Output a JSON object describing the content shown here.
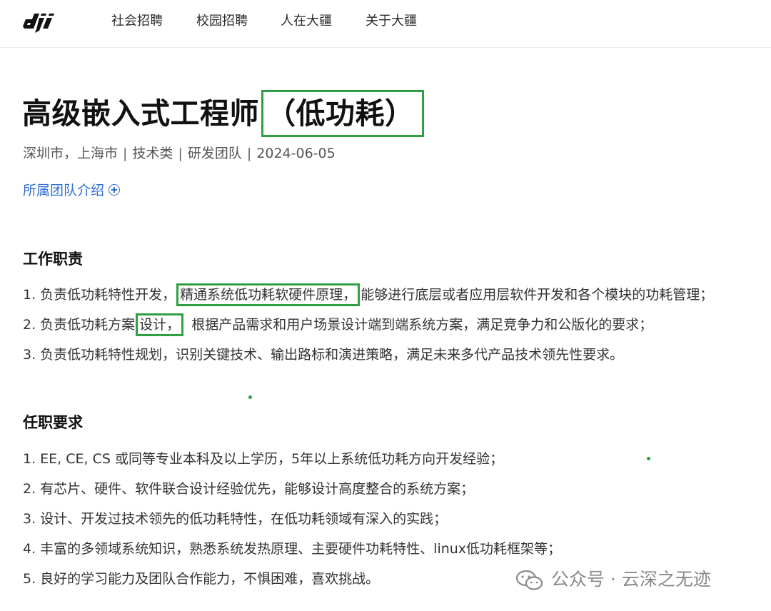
{
  "nav": {
    "logo_text": "dji",
    "items": [
      "社会招聘",
      "校园招聘",
      "人在大疆",
      "关于大疆"
    ]
  },
  "job": {
    "title_main": "高级嵌入式工程师",
    "title_highlight": "（低功耗）",
    "meta": [
      "深圳市，上海市",
      "技术类",
      "研发团队",
      "2024-06-05"
    ],
    "meta_separator": "|",
    "team_link": "所属团队介绍"
  },
  "responsibilities": {
    "heading": "工作职责",
    "items": [
      {
        "before": "1. 负责低功耗特性开发，",
        "highlight": "精通系统低功耗软硬件原理，",
        "after": "能够进行底层或者应用层软件开发和各个模块的功耗管理；"
      },
      {
        "before": "2. 负责低功耗方案",
        "highlight": "设计，",
        "after": "根据产品需求和用户场景设计端到端系统方案，满足竞争力和公版化的要求；"
      },
      {
        "text": "3. 负责低功耗特性规划，识别关键技术、输出路标和演进策略，满足未来多代产品技术领先性要求。"
      }
    ]
  },
  "requirements": {
    "heading": "任职要求",
    "items": [
      "1. EE, CE, CS 或同等专业本科及以上学历，5年以上系统低功耗方向开发经验；",
      "2. 有芯片、硬件、软件联合设计经验优先，能够设计高度整合的系统方案；",
      "3. 设计、开发过技术领先的低功耗特性，在低功耗领域有深入的实践；",
      "4. 丰富的多领域系统知识，熟悉系统发热原理、主要硬件功耗特性、linux低功耗框架等；",
      "5. 良好的学习能力及团队合作能力，不惧困难，喜欢挑战。"
    ]
  },
  "watermark": {
    "text": "公众号 · 云深之无迹",
    "icon": "wechat-icon"
  },
  "colors": {
    "highlight_box": "#2ea043",
    "link": "#2f6fd6"
  }
}
